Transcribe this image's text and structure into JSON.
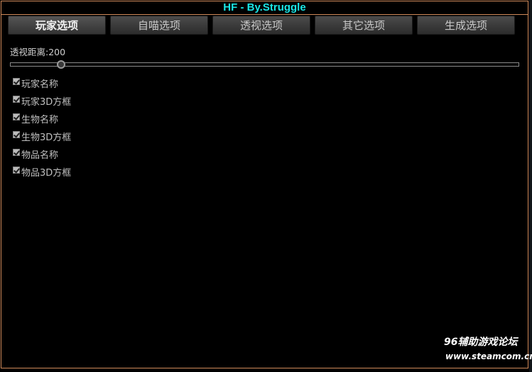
{
  "window": {
    "title": "HF - By.Struggle"
  },
  "tabs": [
    {
      "label": "玩家选项",
      "active": true
    },
    {
      "label": "自喵选项",
      "active": false
    },
    {
      "label": "透视选项",
      "active": false
    },
    {
      "label": "其它选项",
      "active": false
    },
    {
      "label": "生成选项",
      "active": false
    }
  ],
  "slider": {
    "label": "透视距离:200",
    "value": 200,
    "level_fraction": 0.1
  },
  "options": [
    {
      "label": "玩家名称",
      "checked": true
    },
    {
      "label": "玩家3D方框",
      "checked": true
    },
    {
      "label": "生物名称",
      "checked": true
    },
    {
      "label": "生物3D方框",
      "checked": true
    },
    {
      "label": "物品名称",
      "checked": true
    },
    {
      "label": "物品3D方框",
      "checked": true
    }
  ],
  "watermark": {
    "line1": "96辅助游戏论坛",
    "line2": "www.steamcom.cn"
  },
  "colors": {
    "title": "#19e6e6",
    "border": "#d08a5a",
    "background": "#000000"
  }
}
